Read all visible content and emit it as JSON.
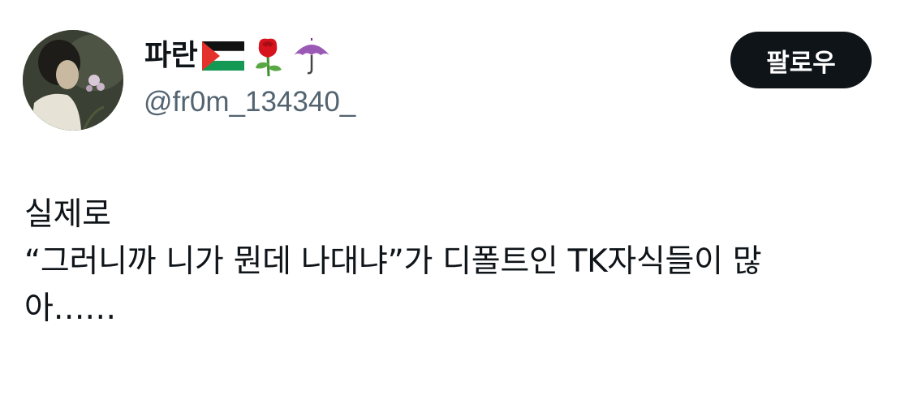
{
  "author": {
    "display_name": "파란",
    "handle": "@fr0m_134340_",
    "name_emojis": [
      {
        "name": "palestine-flag-icon",
        "char": "🇵🇸"
      },
      {
        "name": "rose-icon",
        "char": "🌹"
      },
      {
        "name": "umbrella-icon",
        "char": "☂️"
      }
    ]
  },
  "follow_button": {
    "label": "팔로우"
  },
  "tweet": {
    "lines": [
      "실제로",
      "“그러니까 니가 뭔데 나대냐”가 디폴트인 TK자식들이 많",
      "아……"
    ]
  },
  "colors": {
    "text_primary": "#0f1419",
    "text_secondary": "#536471",
    "button_bg": "#0f1419",
    "button_text": "#ffffff"
  }
}
